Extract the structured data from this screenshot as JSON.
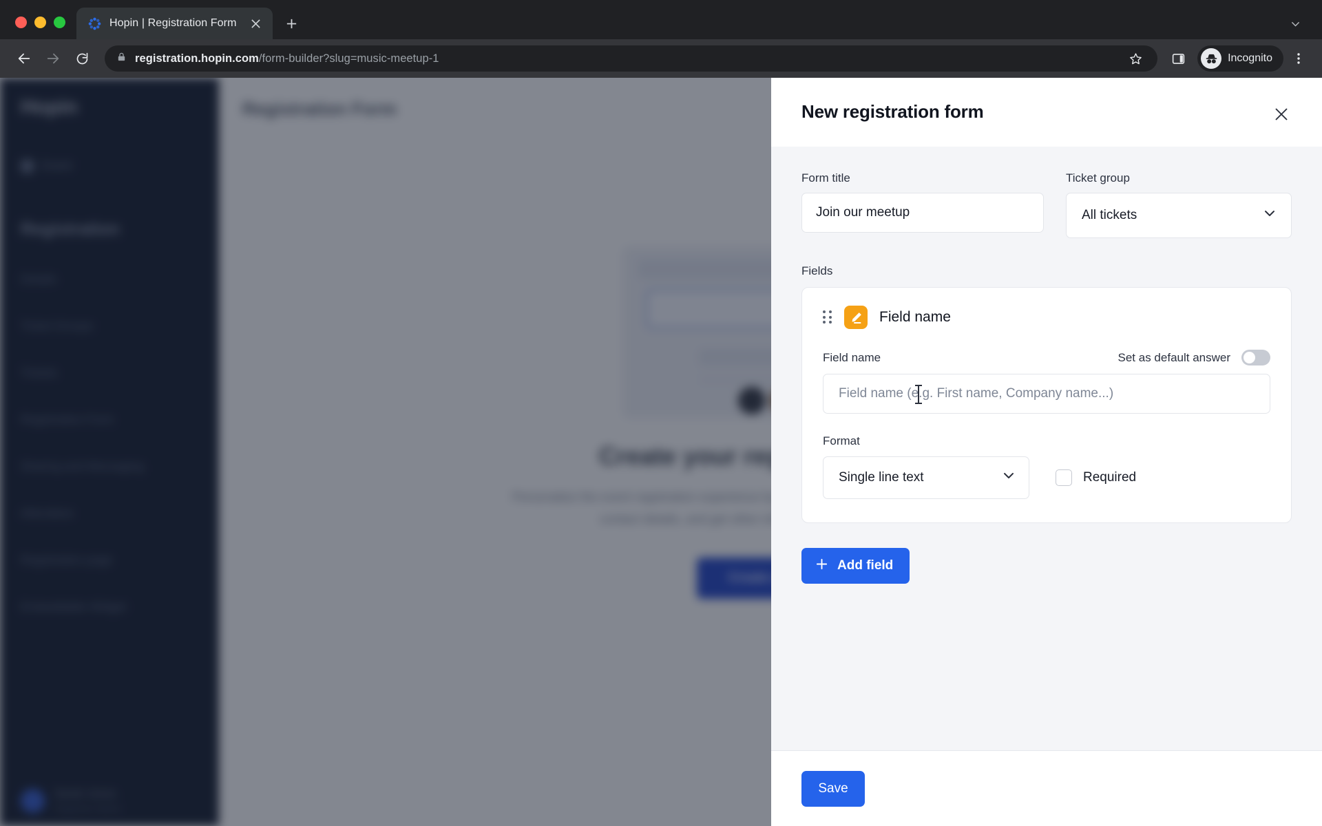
{
  "browser": {
    "tab": {
      "title": "Hopin | Registration Form",
      "favicon_icon": "hopin-logo-icon",
      "close_icon": "close-icon"
    },
    "new_tab_icon": "plus-icon",
    "tab_list_icon": "chevron-down-icon",
    "back_icon": "back-arrow-icon",
    "forward_icon": "forward-arrow-icon",
    "reload_icon": "reload-icon",
    "lock_icon": "lock-icon",
    "url_domain": "registration.hopin.com",
    "url_path": "/form-builder?slug=music-meetup-1",
    "bookmark_icon": "star-icon",
    "sidepanel_icon": "side-panel-icon",
    "incognito_label": "Incognito",
    "incognito_icon": "incognito-icon",
    "menu_icon": "kebab-menu-icon"
  },
  "app": {
    "sidebar": {
      "logo": "Hopin",
      "nav_item": "Event",
      "section": "Registration",
      "links": [
        "Details",
        "Ticket Groups",
        "Tickets",
        "Registration Form",
        "Sharing and Messaging",
        "Attendees",
        "Registration page",
        "Embeddable Widget"
      ],
      "user_name": "Sarah Jones",
      "user_role": "Organizer Admin"
    },
    "page_title": "Registration Form",
    "empty_state": {
      "heading": "Create your registration form",
      "body": "Personalize the event registration experience by creating a form. You can ask for name, email, contact details, and get other information from your attendees.",
      "button": "Create a form"
    }
  },
  "panel": {
    "title": "New registration form",
    "close_icon": "close-icon",
    "form_title": {
      "label": "Form title",
      "value": "Join our meetup"
    },
    "ticket_group": {
      "label": "Ticket group",
      "value": "All tickets",
      "chevron_icon": "chevron-down-icon"
    },
    "fields_label": "Fields",
    "field_card": {
      "drag_icon": "drag-handle-icon",
      "type_icon": "pencil-edit-icon",
      "header_title": "Field name",
      "name_label": "Field name",
      "default_answer_label": "Set as default answer",
      "default_answer_on": false,
      "name_placeholder": "Field name (e.g. First name, Company name...)",
      "name_value": "",
      "format_label": "Format",
      "format_value": "Single line text",
      "format_chevron_icon": "chevron-down-icon",
      "required_label": "Required",
      "required_checked": false
    },
    "add_field": {
      "label": "Add field",
      "icon": "plus-icon"
    },
    "save": {
      "label": "Save"
    }
  },
  "colors": {
    "accent_blue": "#2563eb",
    "field_icon_orange": "#f5a115",
    "panel_bg": "#f4f5f8",
    "sidebar_navy": "#0d1527"
  }
}
